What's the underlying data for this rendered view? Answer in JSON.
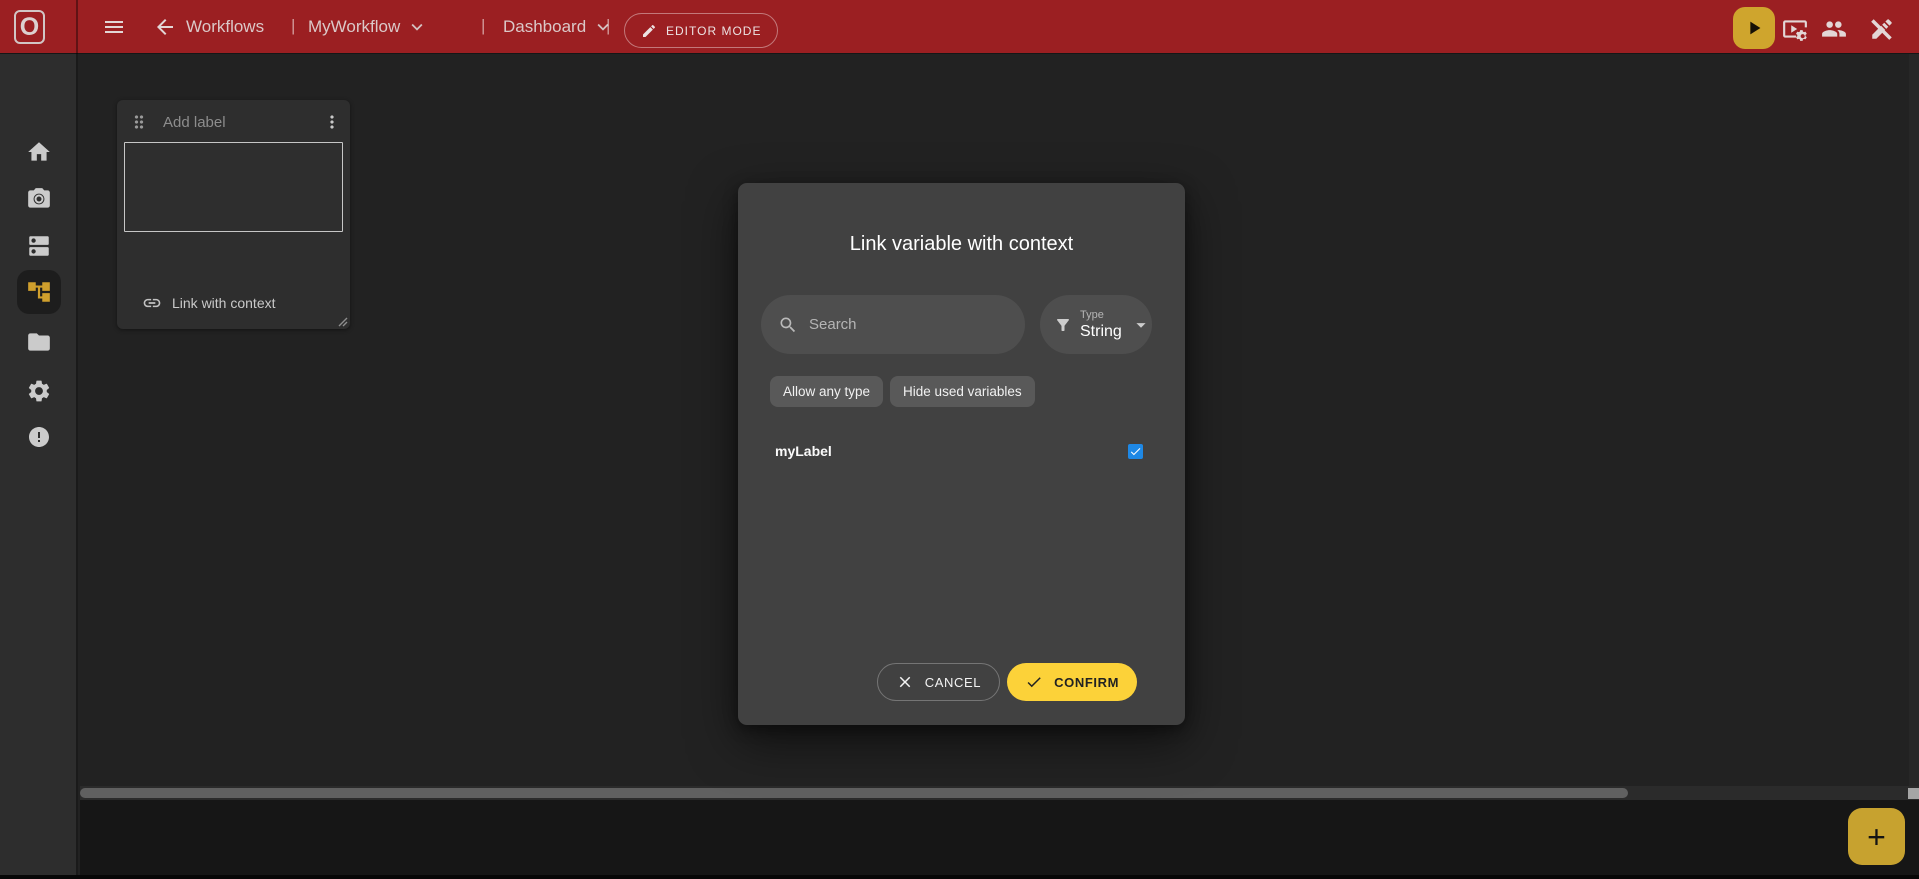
{
  "topbar": {
    "logo_letter": "O",
    "separator": "|",
    "workflows_label": "Workflows",
    "workflow_name": "MyWorkflow",
    "view_name": "Dashboard",
    "editor_mode_label": "EDITOR MODE",
    "icons": [
      "menu-icon",
      "arrow-back-icon",
      "chevron-down-icon",
      "pencil-icon",
      "play-icon",
      "video-settings-icon",
      "users-icon",
      "exit-editor-icon"
    ]
  },
  "sidebar": {
    "active_item": "workflow-editor",
    "icons": [
      "home-icon",
      "camera-icon",
      "widgets-icon",
      "workflow-tree-icon",
      "folder-icon",
      "settings-icon",
      "error-icon"
    ]
  },
  "canvas": {
    "widget": {
      "label_placeholder": "Add label",
      "link_button_label": "Link with context",
      "icons": [
        "drag-handle-icon",
        "kebab-menu-icon",
        "link-icon",
        "resize-handle-icon"
      ]
    }
  },
  "dialog": {
    "title": "Link variable with context",
    "search_placeholder": "Search",
    "type_filter": {
      "label": "Type",
      "value": "String"
    },
    "chips": [
      "Allow any type",
      "Hide used variables"
    ],
    "variables": [
      {
        "name": "myLabel",
        "checked": true
      }
    ],
    "cancel_label": "CANCEL",
    "confirm_label": "CONFIRM",
    "icons": [
      "search-icon",
      "filter-icon",
      "dropdown-caret-icon",
      "close-icon",
      "check-icon",
      "checkbox"
    ]
  },
  "fab": {
    "label": "+"
  },
  "colors": {
    "topbar_red": "#9b1f22",
    "accent_yellow_bright": "#fcd239",
    "accent_yellow_dim": "#c9a42f",
    "checkbox_blue": "#1e88e5",
    "modal_bg": "#414141"
  }
}
